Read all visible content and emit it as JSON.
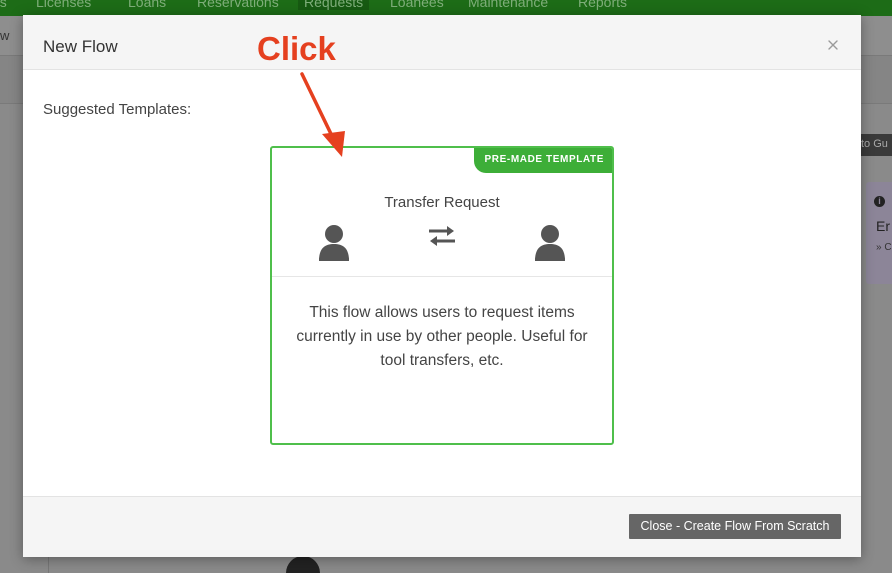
{
  "background": {
    "nav_items": [
      "es",
      "Licenses",
      "Loans",
      "Reservations",
      "Requests",
      "Loanees",
      "Maintenance",
      "Reports"
    ],
    "active_nav": "Requests",
    "view_label": "w",
    "side_button": "to Gu",
    "side_card": {
      "line1": "Er",
      "line2": "» C"
    }
  },
  "modal": {
    "title": "New Flow",
    "close_glyph": "×",
    "subheading": "Suggested Templates:",
    "template": {
      "badge": "PRE-MADE TEMPLATE",
      "title": "Transfer Request",
      "icons": [
        "user-icon",
        "swap-arrows-icon",
        "user-icon"
      ],
      "description": "This flow allows users to request items currently in use by other people. Useful for tool transfers, etc."
    },
    "footer": {
      "close_button": "Close - Create Flow From Scratch"
    }
  },
  "annotation": {
    "text": "Click",
    "color": "#e5401f"
  },
  "colors": {
    "nav_green": "#1d6c17",
    "template_border": "#4fbf4b",
    "badge_green": "#3dae38",
    "button_gray": "#666666"
  }
}
